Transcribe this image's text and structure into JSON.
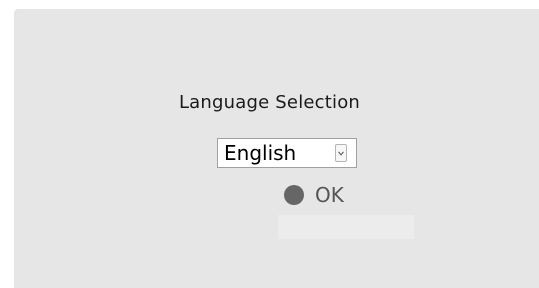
{
  "dialog": {
    "title": "Language Selection",
    "language_select": {
      "selected": "English"
    },
    "ok_button": {
      "label": "OK"
    }
  },
  "colors": {
    "panel_background": "#e6e6e6",
    "ok_dot": "#666666",
    "text": "#1a1a1a"
  }
}
